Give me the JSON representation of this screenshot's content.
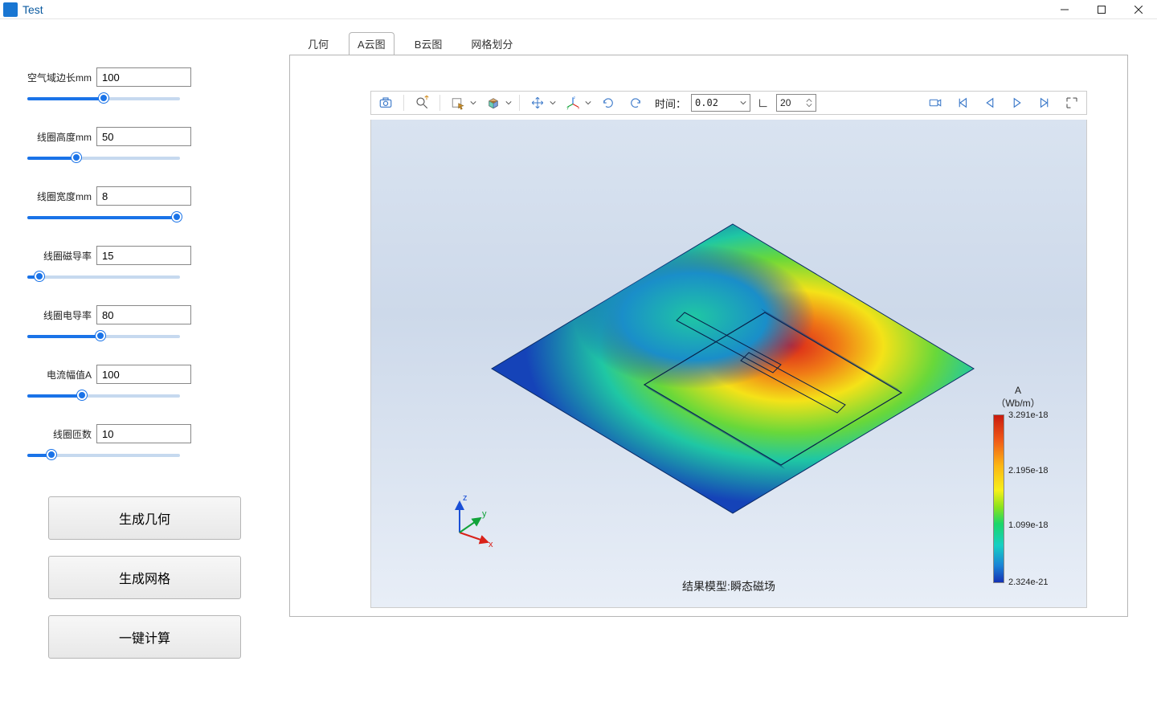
{
  "window": {
    "title": "Test"
  },
  "params": [
    {
      "label": "空气域边长mm",
      "value": "100",
      "slider_pct": 50
    },
    {
      "label": "线圈高度mm",
      "value": "50",
      "slider_pct": 32
    },
    {
      "label": "线圈宽度mm",
      "value": "8",
      "slider_pct": 98
    },
    {
      "label": "线圈磁导率",
      "value": "15",
      "slider_pct": 8
    },
    {
      "label": "线圈电导率",
      "value": "80",
      "slider_pct": 48
    },
    {
      "label": "电流幅值A",
      "value": "100",
      "slider_pct": 36
    },
    {
      "label": "线圈匝数",
      "value": "10",
      "slider_pct": 16
    }
  ],
  "buttons": {
    "generate_geometry": "生成几何",
    "generate_mesh": "生成网格",
    "compute": "一键计算"
  },
  "tabs": {
    "geometry": "几何",
    "a_plot": "A云图",
    "b_plot": "B云图",
    "mesh": "网格划分",
    "active": "a_plot"
  },
  "toolbar": {
    "time_label": "时间：",
    "time_value": "0.02",
    "frame_value": "20"
  },
  "colorbar": {
    "title_line1": "A",
    "title_line2": "（Wb/m）",
    "ticks": [
      {
        "value": "3.291e-18",
        "pos": 0
      },
      {
        "value": "2.195e-18",
        "pos": 33
      },
      {
        "value": "1.099e-18",
        "pos": 66
      },
      {
        "value": "2.324e-21",
        "pos": 100
      }
    ]
  },
  "plot": {
    "caption": "结果模型:瞬态磁场"
  },
  "axes": {
    "x": "x",
    "y": "y",
    "z": "z"
  }
}
